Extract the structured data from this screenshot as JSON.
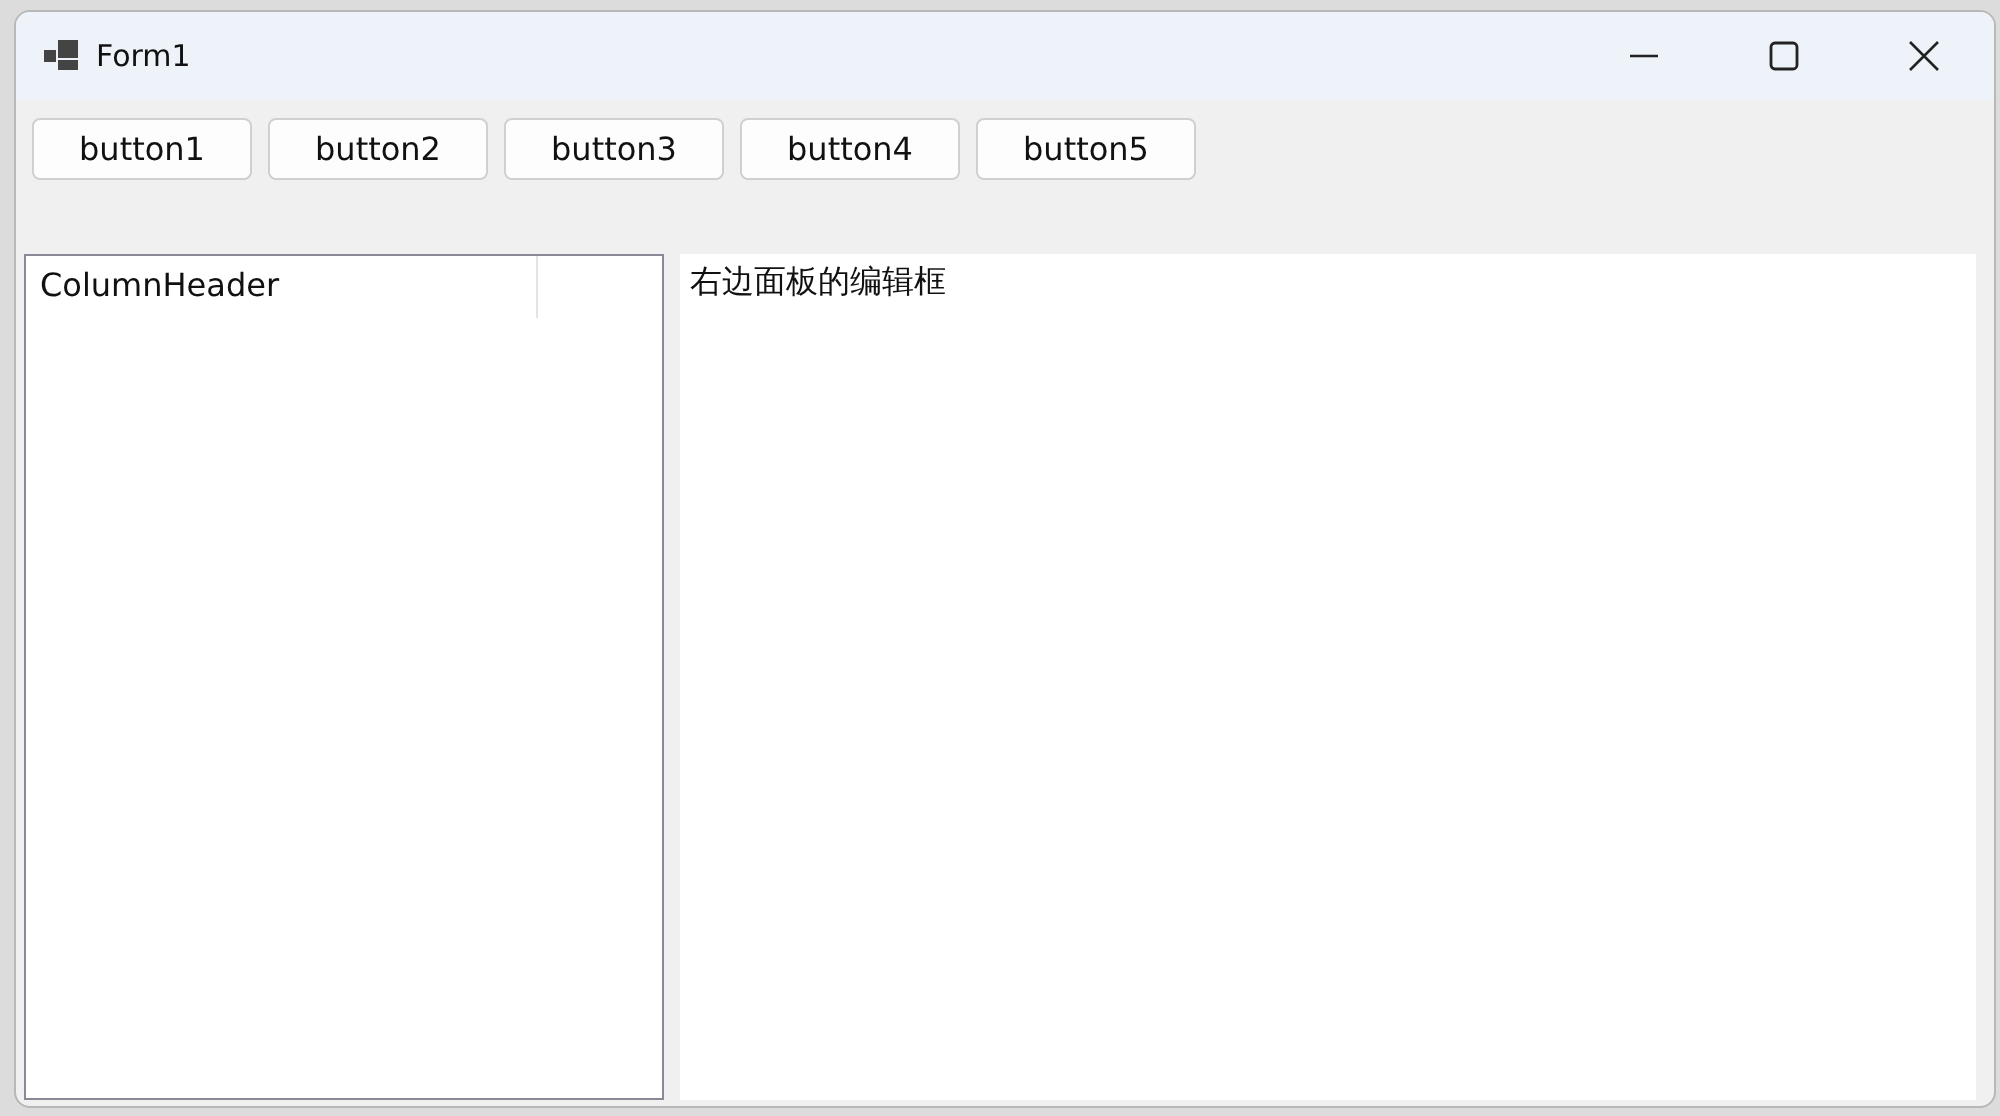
{
  "window": {
    "title": "Form1"
  },
  "buttons": [
    "button1",
    "button2",
    "button3",
    "button4",
    "button5"
  ],
  "list_view": {
    "columns": [
      "ColumnHeader"
    ]
  },
  "text_box": {
    "value": "右边面板的编辑框"
  }
}
